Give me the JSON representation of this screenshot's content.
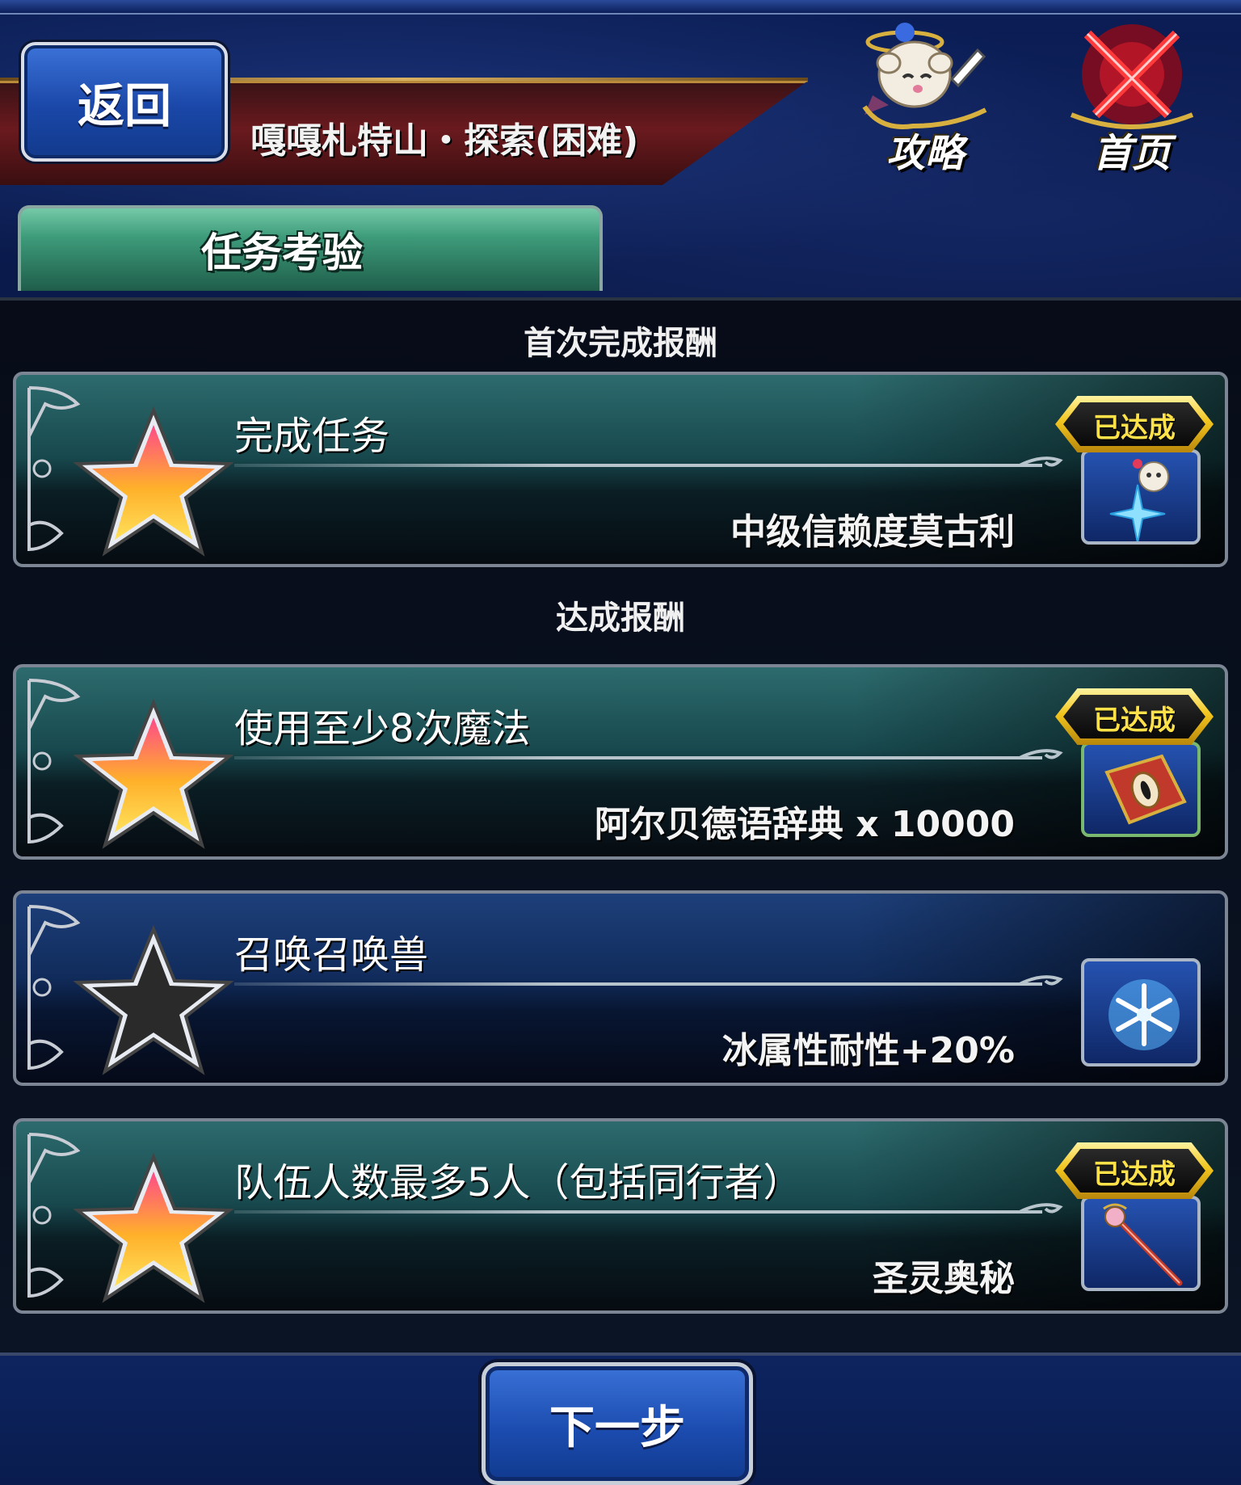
{
  "header": {
    "back_label": "返回",
    "stage_title": "嘎嘎札特山・探索(困难)",
    "guide_label": "攻略",
    "home_label": "首页"
  },
  "tab": {
    "label": "任务考验"
  },
  "sections": {
    "first_clear": "首次完成报酬",
    "achievement": "达成报酬"
  },
  "missions": [
    {
      "title": "完成任务",
      "reward": "中级信赖度莫古利",
      "achieved": true,
      "badge": "已达成",
      "reward_icon": "moogle-icon"
    },
    {
      "title": "使用至少8次魔法",
      "reward": "阿尔贝德语辞典 x 10000",
      "achieved": true,
      "badge": "已达成",
      "reward_icon": "book-icon"
    },
    {
      "title": "召唤召唤兽",
      "reward": "冰属性耐性+20%",
      "achieved": false,
      "badge": "",
      "reward_icon": "snowflake-icon"
    },
    {
      "title": "队伍人数最多5人（包括同行者）",
      "reward": "圣灵奥秘",
      "achieved": true,
      "badge": "已达成",
      "reward_icon": "staff-icon"
    }
  ],
  "footer": {
    "next_label": "下一步"
  },
  "colors": {
    "achieved_star": "#f2b01e",
    "pending_star": "#2a2a2a",
    "badge_gold": "#ffe24a"
  }
}
